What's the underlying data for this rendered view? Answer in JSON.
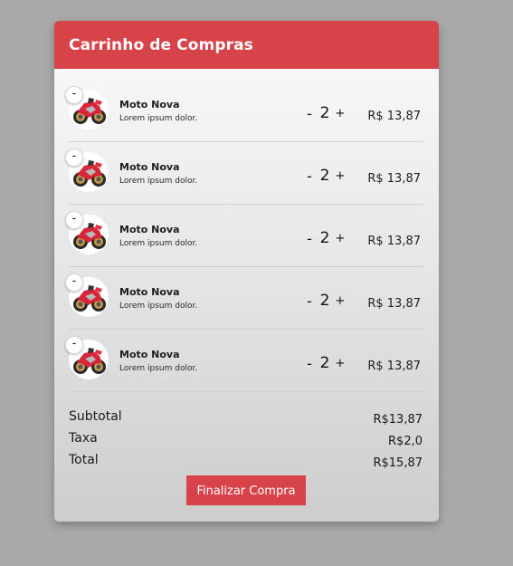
{
  "cart": {
    "title": "Carrinho de Compras",
    "items": [
      {
        "name": "Moto Nova",
        "description": "Lorem ipsum dolor.",
        "quantity": "2",
        "price": "R$ 13,87",
        "remove_label": "-",
        "minus_label": "-",
        "plus_label": "+"
      },
      {
        "name": "Moto Nova",
        "description": "Lorem ipsum dolor.",
        "quantity": "2",
        "price": "R$ 13,87",
        "remove_label": "-",
        "minus_label": "-",
        "plus_label": "+"
      },
      {
        "name": "Moto Nova",
        "description": "Lorem ipsum dolor.",
        "quantity": "2",
        "price": "R$ 13,87",
        "remove_label": "-",
        "minus_label": "-",
        "plus_label": "+"
      },
      {
        "name": "Moto Nova",
        "description": "Lorem ipsum dolor.",
        "quantity": "2",
        "price": "R$ 13,87",
        "remove_label": "-",
        "minus_label": "-",
        "plus_label": "+"
      },
      {
        "name": "Moto Nova",
        "description": "Lorem ipsum dolor.",
        "quantity": "2",
        "price": "R$ 13,87",
        "remove_label": "-",
        "minus_label": "-",
        "plus_label": "+"
      }
    ],
    "summary": {
      "subtotal_label": "Subtotal",
      "subtotal_value": "R$13,87",
      "tax_label": "Taxa",
      "tax_value": "R$2,0",
      "total_label": "Total",
      "total_value": "R$15,87"
    },
    "checkout_label": "Finalizar Compra"
  },
  "colors": {
    "accent": "#d64349",
    "background": "#a9a9a9"
  },
  "icons": {
    "product_image": "motorcycle-icon"
  }
}
